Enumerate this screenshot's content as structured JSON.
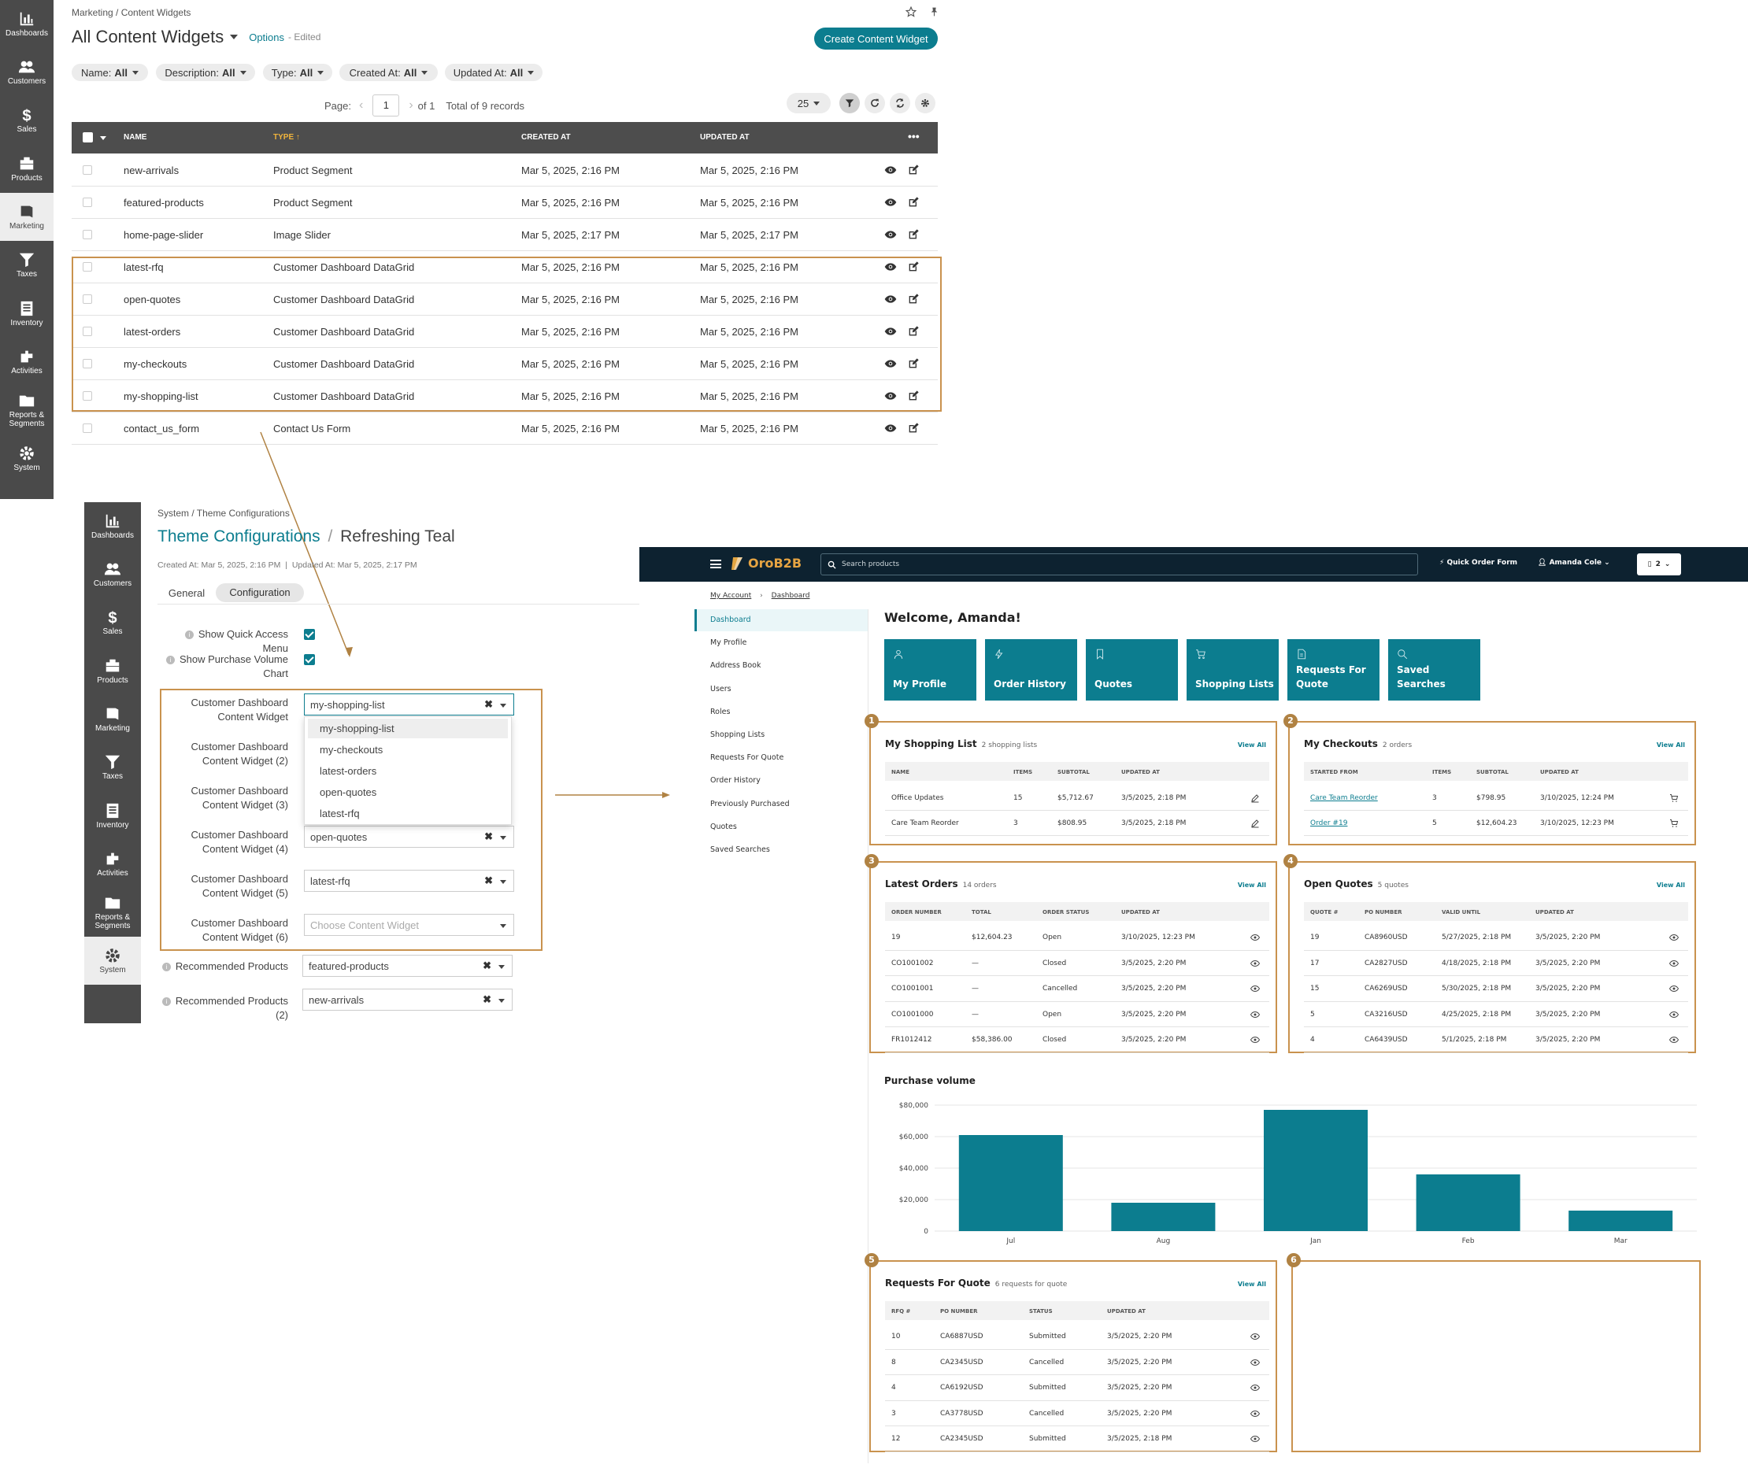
{
  "sidebar_top": {
    "items": [
      "Dashboards",
      "Customers",
      "Sales",
      "Products",
      "Marketing",
      "Taxes",
      "Inventory",
      "Activities",
      "Reports & Segments",
      "System"
    ],
    "active": "Marketing"
  },
  "widgets": {
    "breadcrumb": "Marketing / Content Widgets",
    "title": "All Content Widgets",
    "options": "Options",
    "edited": "- Edited",
    "create_button": "Create Content Widget",
    "filters": [
      {
        "name": "Name:",
        "value": "All"
      },
      {
        "name": "Description:",
        "value": "All"
      },
      {
        "name": "Type:",
        "value": "All"
      },
      {
        "name": "Created At:",
        "value": "All"
      },
      {
        "name": "Updated At:",
        "value": "All"
      }
    ],
    "pager": {
      "label": "Page:",
      "page": "1",
      "of": "of 1",
      "total": "Total of 9 records",
      "per_page": "25"
    },
    "columns": [
      "NAME",
      "TYPE",
      "CREATED AT",
      "UPDATED AT"
    ],
    "rows": [
      {
        "name": "new-arrivals",
        "type": "Product Segment",
        "created": "Mar 5, 2025, 2:16 PM",
        "updated": "Mar 5, 2025, 2:16 PM"
      },
      {
        "name": "featured-products",
        "type": "Product Segment",
        "created": "Mar 5, 2025, 2:16 PM",
        "updated": "Mar 5, 2025, 2:16 PM"
      },
      {
        "name": "home-page-slider",
        "type": "Image Slider",
        "created": "Mar 5, 2025, 2:17 PM",
        "updated": "Mar 5, 2025, 2:17 PM"
      },
      {
        "name": "latest-rfq",
        "type": "Customer Dashboard DataGrid",
        "created": "Mar 5, 2025, 2:16 PM",
        "updated": "Mar 5, 2025, 2:16 PM"
      },
      {
        "name": "open-quotes",
        "type": "Customer Dashboard DataGrid",
        "created": "Mar 5, 2025, 2:16 PM",
        "updated": "Mar 5, 2025, 2:16 PM"
      },
      {
        "name": "latest-orders",
        "type": "Customer Dashboard DataGrid",
        "created": "Mar 5, 2025, 2:16 PM",
        "updated": "Mar 5, 2025, 2:16 PM"
      },
      {
        "name": "my-checkouts",
        "type": "Customer Dashboard DataGrid",
        "created": "Mar 5, 2025, 2:16 PM",
        "updated": "Mar 5, 2025, 2:16 PM"
      },
      {
        "name": "my-shopping-list",
        "type": "Customer Dashboard DataGrid",
        "created": "Mar 5, 2025, 2:16 PM",
        "updated": "Mar 5, 2025, 2:16 PM"
      },
      {
        "name": "contact_us_form",
        "type": "Contact Us Form",
        "created": "Mar 5, 2025, 2:16 PM",
        "updated": "Mar 5, 2025, 2:16 PM"
      }
    ]
  },
  "sidebar_mid": {
    "items": [
      "Dashboards",
      "Customers",
      "Sales",
      "Products",
      "Marketing",
      "Taxes",
      "Inventory",
      "Activities",
      "Reports & Segments",
      "System"
    ],
    "active": "System"
  },
  "theme": {
    "breadcrumb": "System / Theme Configurations",
    "title_link": "Theme Configurations",
    "title_sep": "/",
    "title_name": "Refreshing Teal",
    "meta": "Created At: Mar 5, 2025, 2:16 PM  |  Updated At: Mar 5, 2025, 2:17 PM",
    "tabs": [
      "General",
      "Configuration"
    ],
    "show_quick": "Show Quick Access Menu",
    "show_purchase": [
      "Show Purchase Volume",
      "Chart"
    ],
    "widgets": [
      {
        "label": [
          "Customer Dashboard",
          "Content Widget"
        ],
        "value": "my-shopping-list"
      },
      {
        "label": [
          "Customer Dashboard",
          "Content Widget (2)"
        ],
        "value": ""
      },
      {
        "label": [
          "Customer Dashboard",
          "Content Widget (3)"
        ],
        "value": ""
      },
      {
        "label": [
          "Customer Dashboard",
          "Content Widget (4)"
        ],
        "value": "open-quotes"
      },
      {
        "label": [
          "Customer Dashboard",
          "Content Widget (5)"
        ],
        "value": "latest-rfq"
      },
      {
        "label": [
          "Customer Dashboard",
          "Content Widget (6)"
        ],
        "value": "",
        "placeholder": "Choose Content Widget"
      }
    ],
    "dropdown": [
      "my-shopping-list",
      "my-checkouts",
      "latest-orders",
      "open-quotes",
      "latest-rfq"
    ],
    "rec1": {
      "label": "Recommended Products",
      "value": "featured-products"
    },
    "rec2": {
      "label": [
        "Recommended Products",
        "(2)"
      ],
      "value": "new-arrivals"
    }
  },
  "store": {
    "logo": "OroB2B",
    "search_placeholder": "Search products",
    "quick_order": "Quick Order Form",
    "user": "Amanda Cole",
    "cart_count": "2",
    "crumbs": [
      "My Account",
      "Dashboard"
    ],
    "nav": [
      "Dashboard",
      "My Profile",
      "Address Book",
      "Users",
      "Roles",
      "Shopping Lists",
      "Requests For Quote",
      "Order History",
      "Previously Purchased",
      "Quotes",
      "Saved Searches"
    ],
    "welcome": "Welcome, Amanda!",
    "tiles": [
      "My Profile",
      "Order History",
      "Quotes",
      "Shopping Lists",
      "Requests For Quote",
      "Saved Searches"
    ],
    "view_all": "View All",
    "shopping": {
      "title": "My Shopping List",
      "count": "2 shopping lists",
      "cols": [
        "NAME",
        "ITEMS",
        "SUBTOTAL",
        "UPDATED AT"
      ],
      "rows": [
        [
          "Office Updates",
          "15",
          "$5,712.67",
          "3/5/2025, 2:18 PM"
        ],
        [
          "Care Team Reorder",
          "3",
          "$808.95",
          "3/5/2025, 2:18 PM"
        ]
      ]
    },
    "checkouts": {
      "title": "My Checkouts",
      "count": "2 orders",
      "cols": [
        "STARTED FROM",
        "ITEMS",
        "SUBTOTAL",
        "UPDATED AT"
      ],
      "rows": [
        [
          "Care Team Reorder",
          "3",
          "$798.95",
          "3/10/2025, 12:24 PM"
        ],
        [
          "Order #19",
          "5",
          "$12,604.23",
          "3/10/2025, 12:23 PM"
        ]
      ]
    },
    "orders": {
      "title": "Latest Orders",
      "count": "14 orders",
      "cols": [
        "ORDER NUMBER",
        "TOTAL",
        "ORDER STATUS",
        "UPDATED AT"
      ],
      "rows": [
        [
          "19",
          "$12,604.23",
          "Open",
          "3/10/2025, 12:23 PM"
        ],
        [
          "CO1001002",
          "—",
          "Closed",
          "3/5/2025, 2:20 PM"
        ],
        [
          "CO1001001",
          "—",
          "Cancelled",
          "3/5/2025, 2:20 PM"
        ],
        [
          "CO1001000",
          "—",
          "Open",
          "3/5/2025, 2:20 PM"
        ],
        [
          "FR1012412",
          "$58,386.00",
          "Closed",
          "3/5/2025, 2:20 PM"
        ]
      ]
    },
    "quotes": {
      "title": "Open Quotes",
      "count": "5 quotes",
      "cols": [
        "QUOTE #",
        "PO NUMBER",
        "VALID UNTIL",
        "UPDATED AT"
      ],
      "rows": [
        [
          "19",
          "CA8960USD",
          "5/27/2025, 2:18 PM",
          "3/5/2025, 2:20 PM"
        ],
        [
          "17",
          "CA2827USD",
          "4/18/2025, 2:18 PM",
          "3/5/2025, 2:20 PM"
        ],
        [
          "15",
          "CA6269USD",
          "5/30/2025, 2:18 PM",
          "3/5/2025, 2:20 PM"
        ],
        [
          "5",
          "CA3216USD",
          "4/25/2025, 2:18 PM",
          "3/5/2025, 2:20 PM"
        ],
        [
          "4",
          "CA6439USD",
          "5/1/2025, 2:18 PM",
          "3/5/2025, 2:20 PM"
        ]
      ]
    },
    "rfq": {
      "title": "Requests For Quote",
      "count": "6 requests for quote",
      "cols": [
        "RFQ #",
        "PO NUMBER",
        "STATUS",
        "UPDATED AT"
      ],
      "rows": [
        [
          "10",
          "CA6887USD",
          "Submitted",
          "3/5/2025, 2:20 PM"
        ],
        [
          "8",
          "CA2345USD",
          "Cancelled",
          "3/5/2025, 2:20 PM"
        ],
        [
          "4",
          "CA6192USD",
          "Submitted",
          "3/5/2025, 2:20 PM"
        ],
        [
          "3",
          "CA3778USD",
          "Cancelled",
          "3/5/2025, 2:20 PM"
        ],
        [
          "12",
          "CA2345USD",
          "Submitted",
          "3/5/2025, 2:18 PM"
        ]
      ]
    },
    "badges": [
      "1",
      "2",
      "3",
      "4",
      "5",
      "6"
    ],
    "accent": "#0c7d8f",
    "highlight": "#c9924e"
  },
  "chart_data": {
    "type": "bar",
    "title": "Purchase volume",
    "categories": [
      "Jul",
      "Aug",
      "Jan",
      "Feb",
      "Mar"
    ],
    "values": [
      61000,
      18000,
      77000,
      36000,
      13000
    ],
    "yticks": [
      "$80,000",
      "$60,000",
      "$40,000",
      "$20,000",
      "0"
    ],
    "ylim": [
      0,
      80000
    ],
    "color": "#0c7d8f"
  }
}
